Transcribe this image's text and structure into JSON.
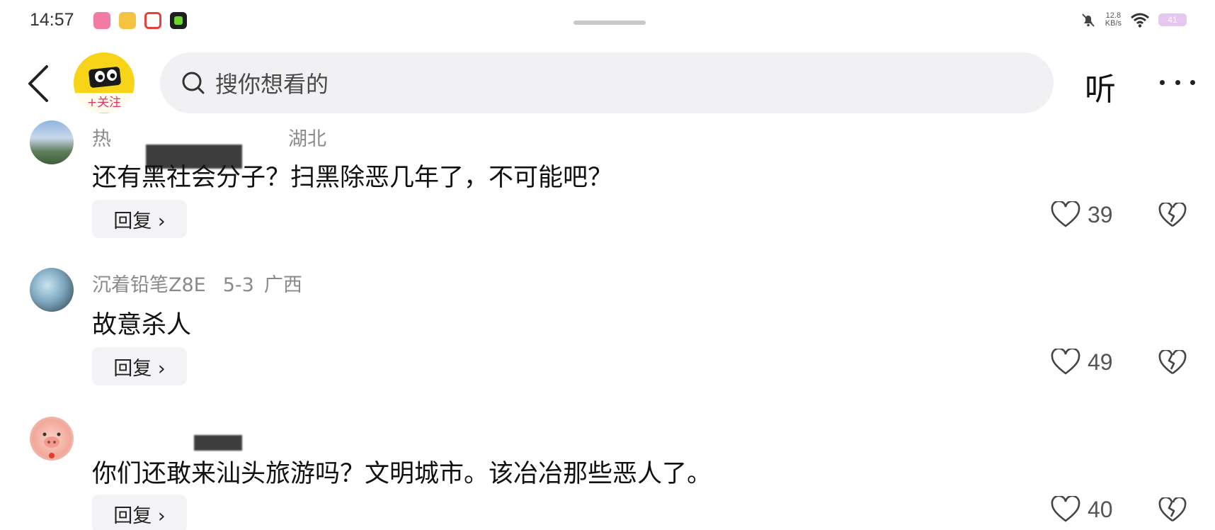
{
  "status_bar": {
    "time": "14:57",
    "app_icons": [
      {
        "name": "bilibili-app-icon",
        "color": "#f47aa6"
      },
      {
        "name": "weibo-app-icon",
        "color": "#f5c342"
      },
      {
        "name": "video-app-icon",
        "color": "#e8413c"
      },
      {
        "name": "green-app-icon",
        "color": "#1f1f1f"
      }
    ],
    "net_speed_value": "12.8",
    "net_speed_unit": "KB/s",
    "battery": "41"
  },
  "header": {
    "follow_label": "+关注",
    "search_placeholder": "搜你想看的",
    "listen_label": "听"
  },
  "comments": [
    {
      "user": "热",
      "location": "湖北",
      "text": "还有黑社会分子？扫黑除恶几年了，不可能吧？",
      "reply_label": "回复 ›",
      "likes": "39"
    },
    {
      "user": "沉着铅笔Z8E",
      "date": "5-3",
      "location": "广西",
      "text": "故意杀人",
      "reply_label": "回复 ›",
      "likes": "49"
    },
    {
      "user": "",
      "location": "",
      "text": "你们还敢来汕头旅游吗？文明城市。该冶冶那些恶人了。",
      "reply_label": "回复 ›",
      "likes": "40"
    }
  ],
  "colors": {
    "accent_pink": "#e0336b",
    "avatar_yellow": "#f7d417",
    "search_bg": "#f1f1f3"
  }
}
